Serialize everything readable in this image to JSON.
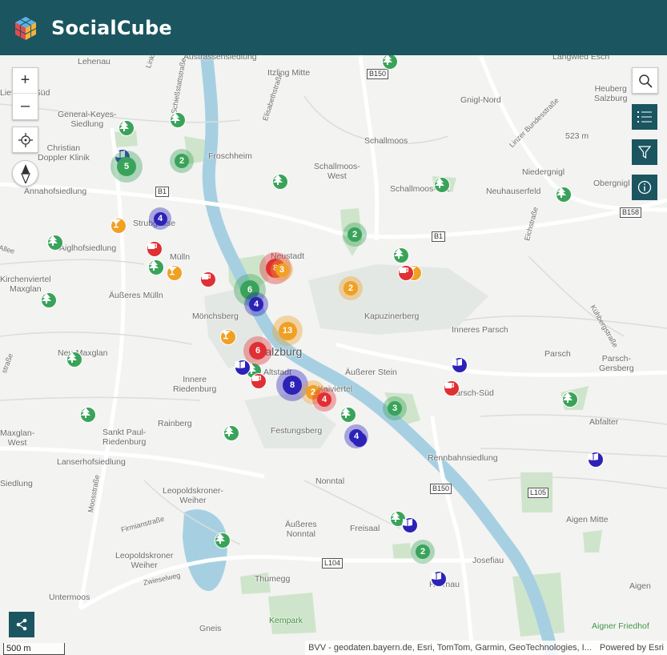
{
  "app": {
    "title": "SocialCube"
  },
  "zoom": {
    "in": "+",
    "out": "–"
  },
  "scale": {
    "label": "500 m"
  },
  "attribution": {
    "sources": "BVV - geodaten.bayern.de, Esri, TomTom, Garmin, GeoTechnologies, I...",
    "powered": "Powered by Esri"
  },
  "road_shields": [
    {
      "id": "b150-top",
      "label": "B150"
    },
    {
      "id": "b1-west",
      "label": "B1"
    },
    {
      "id": "b1-east",
      "label": "B1"
    },
    {
      "id": "b158",
      "label": "B158"
    },
    {
      "id": "b150-south",
      "label": "B150"
    },
    {
      "id": "l105",
      "label": "L105"
    },
    {
      "id": "l104",
      "label": "L104"
    }
  ],
  "place_labels": [
    {
      "id": "lehenau",
      "text": "Lehenau"
    },
    {
      "id": "austrassen",
      "text": "Austrassensiedlung"
    },
    {
      "id": "itzling",
      "text": "Itzling Mitte"
    },
    {
      "id": "langwied",
      "text": "Langwied Esch"
    },
    {
      "id": "liefering",
      "text": "Liefering-Süd"
    },
    {
      "id": "general-keyes",
      "text": "General-Keyes-\nSiedlung"
    },
    {
      "id": "christian-doppler",
      "text": "Christian\nDoppler Klinik"
    },
    {
      "id": "froschheim",
      "text": "Froschheim"
    },
    {
      "id": "gnigl-nord",
      "text": "Gnigl-Nord"
    },
    {
      "id": "heuberg",
      "text": "Heuberg\nSalzburg"
    },
    {
      "id": "schallmoos",
      "text": "Schallmoos"
    },
    {
      "id": "schallmoos-west",
      "text": "Schallmoos-\nWest"
    },
    {
      "id": "schallmoos-ost",
      "text": "Schallmoos-Ost"
    },
    {
      "id": "niedergnigl",
      "text": "Niedergnigl"
    },
    {
      "id": "neuhauserfeld",
      "text": "Neuhauserfeld"
    },
    {
      "id": "obergnigl",
      "text": "Obergnigl"
    },
    {
      "id": "annahof",
      "text": "Annahofsiedlung"
    },
    {
      "id": "strubgasse",
      "text": "Strubgasse"
    },
    {
      "id": "aiglhof",
      "text": "Aiglhofsiedlung"
    },
    {
      "id": "muelln",
      "text": "Mülln"
    },
    {
      "id": "neustadt",
      "text": "Neustadt"
    },
    {
      "id": "kirchenviertel",
      "text": "Kirchenviertel\nMaxglan"
    },
    {
      "id": "aeusseres-muelln",
      "text": "Äußeres Mülln"
    },
    {
      "id": "moenchsberg",
      "text": "Mönchsberg"
    },
    {
      "id": "kapuzinerberg",
      "text": "Kapuzinerberg"
    },
    {
      "id": "inneres-parsch",
      "text": "Inneres Parsch"
    },
    {
      "id": "neu-maxglan",
      "text": "Neu-Maxglan"
    },
    {
      "id": "salzburg",
      "text": "Salzburg"
    },
    {
      "id": "parsch",
      "text": "Parsch"
    },
    {
      "id": "parsch-gersberg",
      "text": "Parsch-\nGersberg"
    },
    {
      "id": "altstadt",
      "text": "Altstadt"
    },
    {
      "id": "aeusserer-stein",
      "text": "Äußerer Stein"
    },
    {
      "id": "innere-riedenburg",
      "text": "Innere\nRiedenburg"
    },
    {
      "id": "kaiviertel",
      "text": "Kaiviertel"
    },
    {
      "id": "parsch-sued",
      "text": "Parsch-Süd"
    },
    {
      "id": "abfalter",
      "text": "Abfalter"
    },
    {
      "id": "rainberg",
      "text": "Rainberg"
    },
    {
      "id": "festungsberg",
      "text": "Festungsberg"
    },
    {
      "id": "maxglan-west",
      "text": "Maxglan-\nWest"
    },
    {
      "id": "sankt-paul",
      "text": "Sankt Paul-\nRiedenburg"
    },
    {
      "id": "rennbahn",
      "text": "Rennbahnsiedlung"
    },
    {
      "id": "lanserhof",
      "text": "Lanserhofsiedlung"
    },
    {
      "id": "siedlung-west",
      "text": "Siedlung"
    },
    {
      "id": "nonntal",
      "text": "Nonntal"
    },
    {
      "id": "leopoldskroner-weiher-top",
      "text": "Leopoldskroner-\nWeiher"
    },
    {
      "id": "aeusseres-nonntal",
      "text": "Äußeres\nNonntal"
    },
    {
      "id": "freisaal",
      "text": "Freisaal"
    },
    {
      "id": "aigen-mitte",
      "text": "Aigen Mitte"
    },
    {
      "id": "leopoldskroner-weiher",
      "text": "Leopoldskroner\nWeiher"
    },
    {
      "id": "josefiau",
      "text": "Josefiau"
    },
    {
      "id": "herrnau",
      "text": "Herrnau"
    },
    {
      "id": "thumegg",
      "text": "Thumegg"
    },
    {
      "id": "untermoos",
      "text": "Untermoos"
    },
    {
      "id": "aigen",
      "text": "Aigen"
    },
    {
      "id": "kempark",
      "text": "Kempark"
    },
    {
      "id": "gneis",
      "text": "Gneis"
    },
    {
      "id": "aigner-friedhof",
      "text": "Aigner Friedhof"
    },
    {
      "id": "elev",
      "text": "523 m"
    }
  ],
  "street_labels": [
    {
      "id": "linke",
      "text": "Linke"
    },
    {
      "id": "schiessstatt",
      "text": "Schießstattstraße"
    },
    {
      "id": "elisabeth",
      "text": "Elisabethstraße"
    },
    {
      "id": "linzer-bundes",
      "text": "Linzer Bundesstraße"
    },
    {
      "id": "eichstrasse",
      "text": "Eichstraße"
    },
    {
      "id": "kuehberg",
      "text": "Kühbergstraße"
    },
    {
      "id": "moosstrasse",
      "text": "Moosstraße"
    },
    {
      "id": "firmian",
      "text": "Firmianstraße"
    },
    {
      "id": "zwieselweg",
      "text": "Zwieselweg"
    },
    {
      "id": "allee",
      "text": "Allee"
    },
    {
      "id": "strasse-w",
      "text": "straße"
    }
  ],
  "clusters": [
    {
      "type": "green",
      "count": "5"
    },
    {
      "type": "green",
      "count": "2"
    },
    {
      "type": "purple",
      "count": "4"
    },
    {
      "type": "green",
      "count": "2"
    },
    {
      "type": "red",
      "count": "8"
    },
    {
      "type": "orange",
      "count": "3"
    },
    {
      "type": "green",
      "count": "6"
    },
    {
      "type": "purple",
      "count": "4"
    },
    {
      "type": "orange",
      "count": "2"
    },
    {
      "type": "orange",
      "count": "13"
    },
    {
      "type": "red",
      "count": "6"
    },
    {
      "type": "purple",
      "count": "8"
    },
    {
      "type": "orange",
      "count": "2"
    },
    {
      "type": "red",
      "count": "4"
    },
    {
      "type": "green",
      "count": "3"
    },
    {
      "type": "purple",
      "count": "4"
    },
    {
      "type": "green",
      "count": "2"
    }
  ],
  "point_markers": [
    {
      "type": "park"
    },
    {
      "type": "park"
    },
    {
      "type": "park"
    },
    {
      "type": "park"
    },
    {
      "type": "park"
    },
    {
      "type": "park"
    },
    {
      "type": "park"
    },
    {
      "type": "park"
    },
    {
      "type": "park"
    },
    {
      "type": "park"
    },
    {
      "type": "park"
    },
    {
      "type": "park"
    },
    {
      "type": "park"
    },
    {
      "type": "park"
    },
    {
      "type": "park"
    },
    {
      "type": "park"
    },
    {
      "type": "park"
    },
    {
      "type": "park"
    },
    {
      "type": "bar"
    },
    {
      "type": "bar"
    },
    {
      "type": "bar"
    },
    {
      "type": "bar"
    },
    {
      "type": "cafe"
    },
    {
      "type": "cafe"
    },
    {
      "type": "cafe"
    },
    {
      "type": "cafe"
    },
    {
      "type": "cafe"
    },
    {
      "type": "library"
    },
    {
      "type": "library"
    },
    {
      "type": "library"
    },
    {
      "type": "library"
    },
    {
      "type": "library"
    },
    {
      "type": "library"
    },
    {
      "type": "library"
    }
  ],
  "colors": {
    "header": "#1a5560",
    "park": "#3aa35a",
    "bar": "#f0a023",
    "cafe": "#e03034",
    "library": "#2d22b8",
    "water": "#a9d3e4",
    "green_area": "#c9e3c6"
  }
}
